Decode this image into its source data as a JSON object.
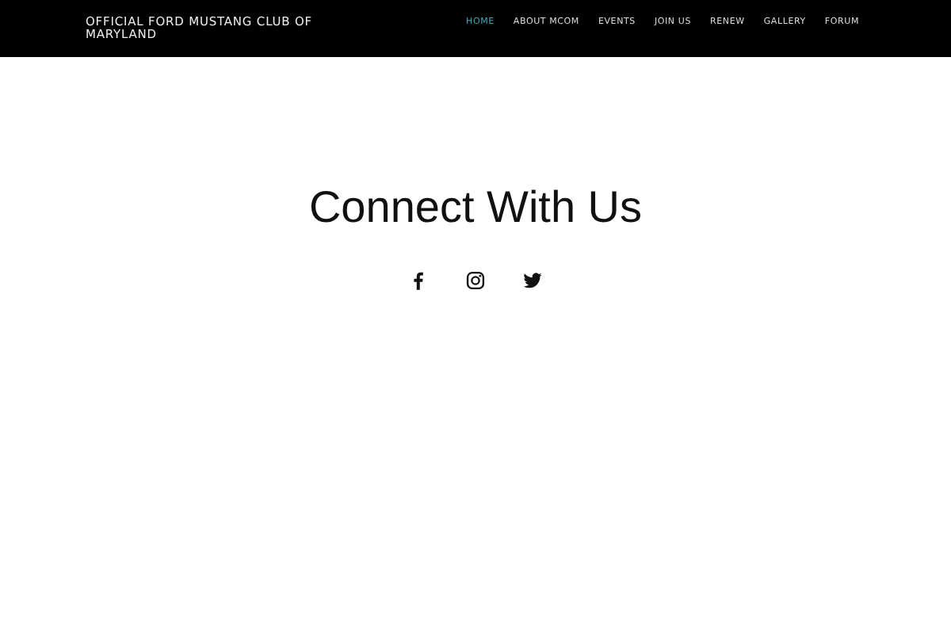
{
  "site_title": "OFFICIAL FORD MUSTANG CLUB OF MARYLAND",
  "nav": [
    {
      "label": "HOME",
      "selected": true
    },
    {
      "label": "ABOUT MCOM",
      "selected": false
    },
    {
      "label": "EVENTS",
      "selected": false
    },
    {
      "label": "JOIN US",
      "selected": false
    },
    {
      "label": "RENEW",
      "selected": false
    },
    {
      "label": "GALLERY",
      "selected": false
    },
    {
      "label": "FORUM",
      "selected": false
    }
  ],
  "heading": "Connect With Us",
  "social": [
    {
      "kind": "letter-f"
    },
    {
      "kind": "camera"
    },
    {
      "kind": "bird"
    }
  ]
}
